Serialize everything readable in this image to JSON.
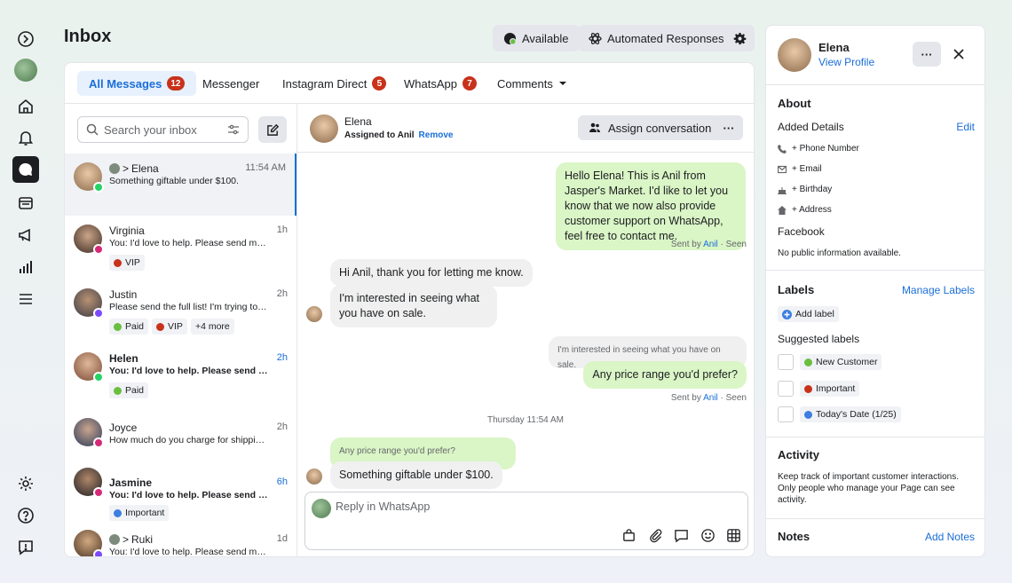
{
  "page": {
    "title": "Inbox"
  },
  "topbar": {
    "available": "Available",
    "automated": "Automated Responses"
  },
  "tabs": [
    {
      "label": "All Messages",
      "count": "12"
    },
    {
      "label": "Messenger"
    },
    {
      "label": "Instagram Direct",
      "count": "5"
    },
    {
      "label": "WhatsApp",
      "count": "7"
    },
    {
      "label": "Comments"
    }
  ],
  "search": {
    "placeholder": "Search your inbox"
  },
  "conversations": [
    {
      "name": "Elena",
      "time": "11:54 AM",
      "snippet": "Something giftable under $100."
    },
    {
      "name": "Virginia",
      "time": "1h",
      "snippet": "You: I'd love to help. Please send me s...",
      "tags": [
        "VIP"
      ]
    },
    {
      "name": "Justin",
      "time": "2h",
      "snippet": "Please send the full list! I'm trying to p...",
      "tags": [
        "Paid",
        "VIP",
        "+4 more"
      ]
    },
    {
      "name": "Helen",
      "time": "2h",
      "snippet": "You: I'd love to help. Please send me s...",
      "tags": [
        "Paid"
      ]
    },
    {
      "name": "Joyce",
      "time": "2h",
      "snippet": "How much do you charge for shipping?"
    },
    {
      "name": "Jasmine",
      "time": "6h",
      "snippet": "You: I'd love to help. Please send me s...",
      "tags": [
        "Important"
      ]
    },
    {
      "name": "Ruki",
      "time": "1d",
      "snippet": "You: I'd love to help. Please send me s..."
    }
  ],
  "chat": {
    "contact": "Elena",
    "assigned": "Assigned to Anil",
    "remove": "Remove",
    "assign_button": "Assign conversation",
    "messages": {
      "m1": "Hello Elena! This is Anil from Jasper's Market. I'd like to let you know that we now also provide customer support on WhatsApp, feel free to contact me.",
      "m2": "Hi Anil, thank you for letting me know.",
      "m3": "I'm interested in seeing what you have on sale.",
      "m4_quote": "I'm interested in seeing what you have on sale.",
      "m4": "Any price range you'd prefer?",
      "m5_quote": "Any price range you'd prefer?",
      "m5": "Something giftable under $100."
    },
    "sent_by": "Sent by",
    "sender": "Anil",
    "seen": "· Seen",
    "date_divider": "Thursday 11:54 AM",
    "reply_placeholder": "Reply in WhatsApp"
  },
  "profile": {
    "name": "Elena",
    "view_profile": "View Profile",
    "about": "About",
    "added_details": "Added Details",
    "edit": "Edit",
    "phone": "+ Phone Number",
    "email": "+ Email",
    "birthday": "+ Birthday",
    "address": "+ Address",
    "facebook": "Facebook",
    "no_info": "No public information available.",
    "labels": "Labels",
    "manage_labels": "Manage Labels",
    "add_label": "Add label",
    "suggested": "Suggested labels",
    "suggested_items": [
      "New Customer",
      "Important",
      "Today's Date (1/25)"
    ],
    "activity": "Activity",
    "activity_text": "Keep track of important customer interactions. Only people who manage your Page can see activity.",
    "notes": "Notes",
    "add_notes": "Add Notes"
  },
  "colors": {
    "accent": "#1a6ed8",
    "badge": "#c8321b",
    "green": "#6abf3f",
    "red": "#c8321b",
    "blue": "#3d7fe0",
    "whatsapp": "#25d366",
    "instagram": "#d62976"
  }
}
